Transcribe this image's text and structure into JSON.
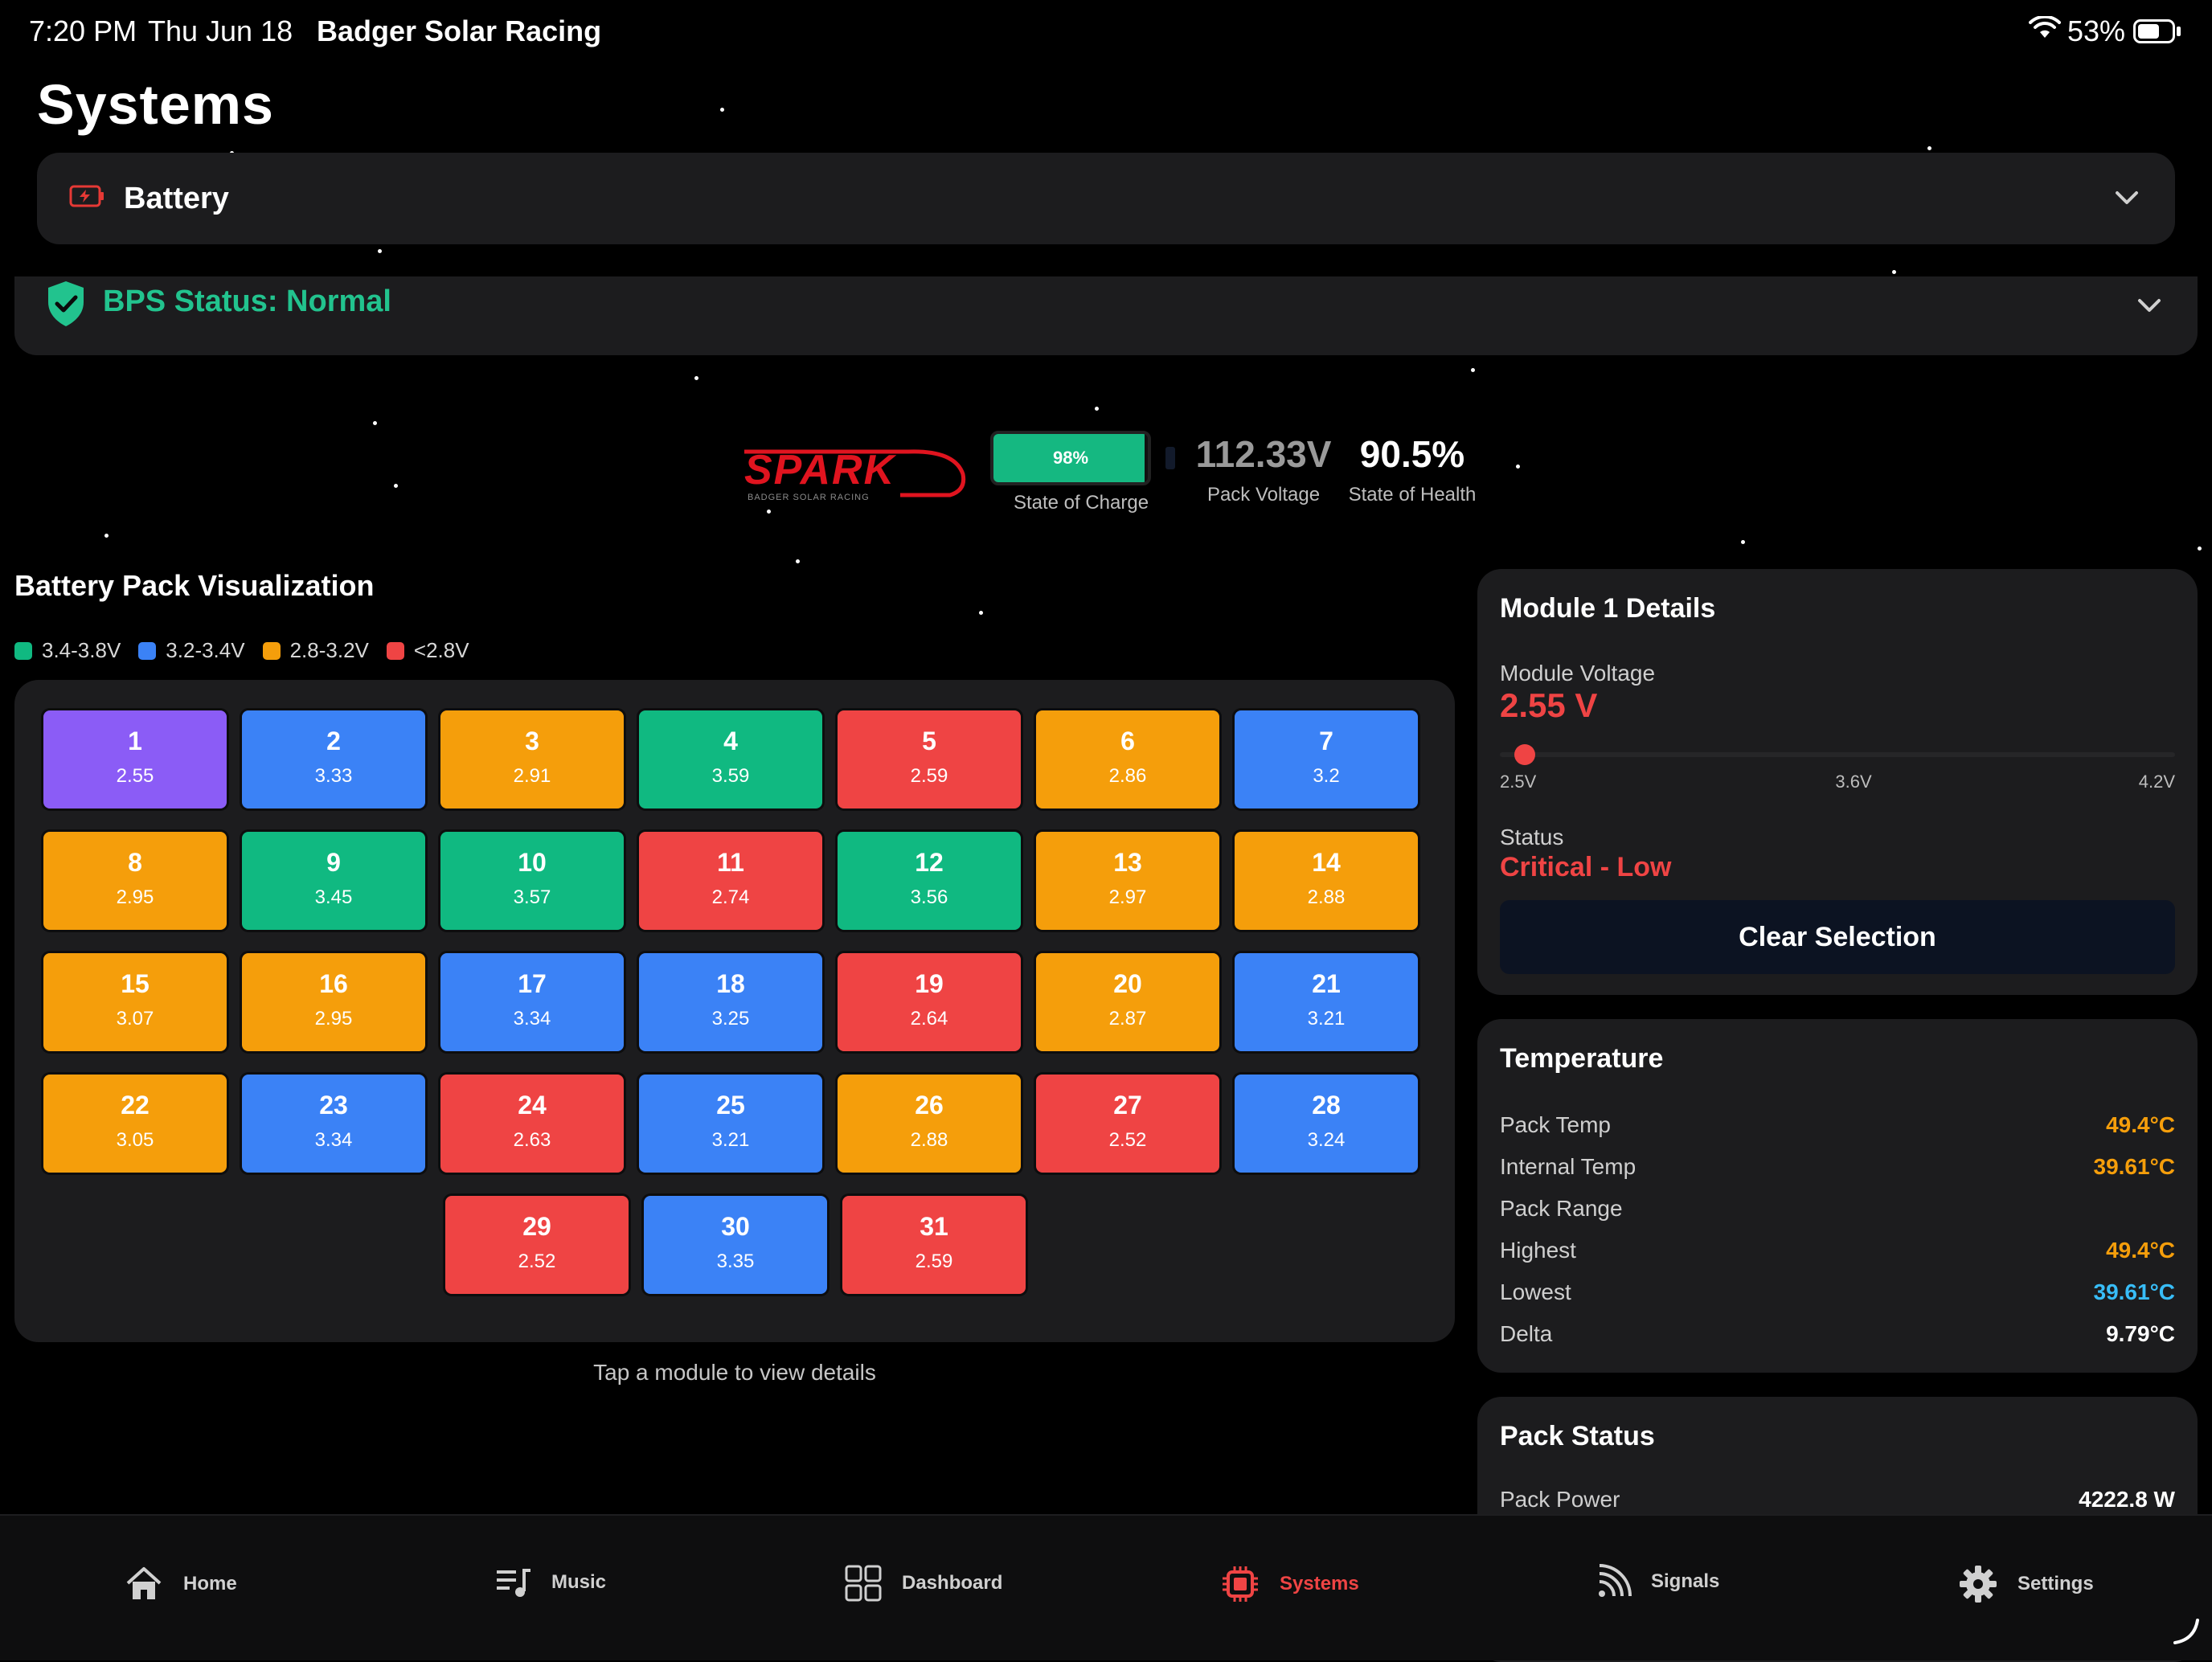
{
  "status_bar": {
    "time": "7:20 PM",
    "date": "Thu Jun 18",
    "app_name": "Badger Solar Racing",
    "battery_pct": "53%",
    "battery_level": 0.53
  },
  "page": {
    "title": "Systems"
  },
  "system_selector": {
    "selected": "Battery",
    "icon": "battery-icon"
  },
  "bps_status": {
    "label": "BPS Status: Normal",
    "icon": "shield-check-icon",
    "color": "#22c38e"
  },
  "overview": {
    "logo_text": "SPARK",
    "logo_subtext": "BADGER SOLAR RACING",
    "soc_value": "98%",
    "soc_level": 0.98,
    "soc_label": "State of Charge",
    "pack_voltage": "112.33V",
    "pack_voltage_label": "Pack Voltage",
    "soh": "90.5%",
    "soh_label": "State of Health"
  },
  "visualization": {
    "title": "Battery Pack Visualization",
    "legend": [
      {
        "label": "3.4-3.8V",
        "color": "#10b981"
      },
      {
        "label": "3.2-3.4V",
        "color": "#3b82f6"
      },
      {
        "label": "2.8-3.2V",
        "color": "#f59e0b"
      },
      {
        "label": "<2.8V",
        "color": "#ef4444"
      }
    ],
    "hint": "Tap a module to view details",
    "modules": [
      {
        "id": "1",
        "voltage": "2.55",
        "color": "#8b5cf6"
      },
      {
        "id": "2",
        "voltage": "3.33",
        "color": "#3b82f6"
      },
      {
        "id": "3",
        "voltage": "2.91",
        "color": "#f59e0b"
      },
      {
        "id": "4",
        "voltage": "3.59",
        "color": "#10b981"
      },
      {
        "id": "5",
        "voltage": "2.59",
        "color": "#ef4444"
      },
      {
        "id": "6",
        "voltage": "2.86",
        "color": "#f59e0b"
      },
      {
        "id": "7",
        "voltage": "3.2",
        "color": "#3b82f6"
      },
      {
        "id": "8",
        "voltage": "2.95",
        "color": "#f59e0b"
      },
      {
        "id": "9",
        "voltage": "3.45",
        "color": "#10b981"
      },
      {
        "id": "10",
        "voltage": "3.57",
        "color": "#10b981"
      },
      {
        "id": "11",
        "voltage": "2.74",
        "color": "#ef4444"
      },
      {
        "id": "12",
        "voltage": "3.56",
        "color": "#10b981"
      },
      {
        "id": "13",
        "voltage": "2.97",
        "color": "#f59e0b"
      },
      {
        "id": "14",
        "voltage": "2.88",
        "color": "#f59e0b"
      },
      {
        "id": "15",
        "voltage": "3.07",
        "color": "#f59e0b"
      },
      {
        "id": "16",
        "voltage": "2.95",
        "color": "#f59e0b"
      },
      {
        "id": "17",
        "voltage": "3.34",
        "color": "#3b82f6"
      },
      {
        "id": "18",
        "voltage": "3.25",
        "color": "#3b82f6"
      },
      {
        "id": "19",
        "voltage": "2.64",
        "color": "#ef4444"
      },
      {
        "id": "20",
        "voltage": "2.87",
        "color": "#f59e0b"
      },
      {
        "id": "21",
        "voltage": "3.21",
        "color": "#3b82f6"
      },
      {
        "id": "22",
        "voltage": "3.05",
        "color": "#f59e0b"
      },
      {
        "id": "23",
        "voltage": "3.34",
        "color": "#3b82f6"
      },
      {
        "id": "24",
        "voltage": "2.63",
        "color": "#ef4444"
      },
      {
        "id": "25",
        "voltage": "3.21",
        "color": "#3b82f6"
      },
      {
        "id": "26",
        "voltage": "2.88",
        "color": "#f59e0b"
      },
      {
        "id": "27",
        "voltage": "2.52",
        "color": "#ef4444"
      },
      {
        "id": "28",
        "voltage": "3.24",
        "color": "#3b82f6"
      },
      {
        "id": "29",
        "voltage": "2.52",
        "color": "#ef4444"
      },
      {
        "id": "30",
        "voltage": "3.35",
        "color": "#3b82f6"
      },
      {
        "id": "31",
        "voltage": "2.59",
        "color": "#ef4444"
      }
    ]
  },
  "module_details": {
    "title": "Module 1 Details",
    "voltage_label": "Module Voltage",
    "voltage_value": "2.55 V",
    "range_ticks": [
      "2.5V",
      "3.6V",
      "4.2V"
    ],
    "range_min": 2.5,
    "range_max": 4.2,
    "voltage_numeric": 2.55,
    "status_label": "Status",
    "status_value": "Critical - Low",
    "clear_button": "Clear Selection"
  },
  "temperature": {
    "title": "Temperature",
    "rows": [
      {
        "label": "Pack Temp",
        "value": "49.4°C",
        "color": "#f59e0b"
      },
      {
        "label": "Internal Temp",
        "value": "39.61°C",
        "color": "#f59e0b"
      },
      {
        "label": "Pack Range",
        "value": "",
        "color": "#ffffff"
      },
      {
        "label": "Highest",
        "value": "49.4°C",
        "color": "#f59e0b"
      },
      {
        "label": "Lowest",
        "value": "39.61°C",
        "color": "#38bdf8"
      },
      {
        "label": "Delta",
        "value": "9.79°C",
        "color": "#ffffff"
      }
    ]
  },
  "pack_status": {
    "title": "Pack Status",
    "rows": [
      {
        "label": "Pack Power",
        "value": "4222.8 W"
      }
    ]
  },
  "tab_bar": {
    "active": "Systems",
    "tabs": [
      {
        "label": "Home",
        "icon": "home-icon"
      },
      {
        "label": "Music",
        "icon": "music-icon"
      },
      {
        "label": "Dashboard",
        "icon": "dashboard-icon"
      },
      {
        "label": "Systems",
        "icon": "chip-icon"
      },
      {
        "label": "Signals",
        "icon": "signal-icon"
      },
      {
        "label": "Settings",
        "icon": "gear-icon"
      }
    ]
  },
  "colors": {
    "accent_red": "#ef4444",
    "accent_green": "#22c38e",
    "card_bg": "#1c1c1e"
  }
}
